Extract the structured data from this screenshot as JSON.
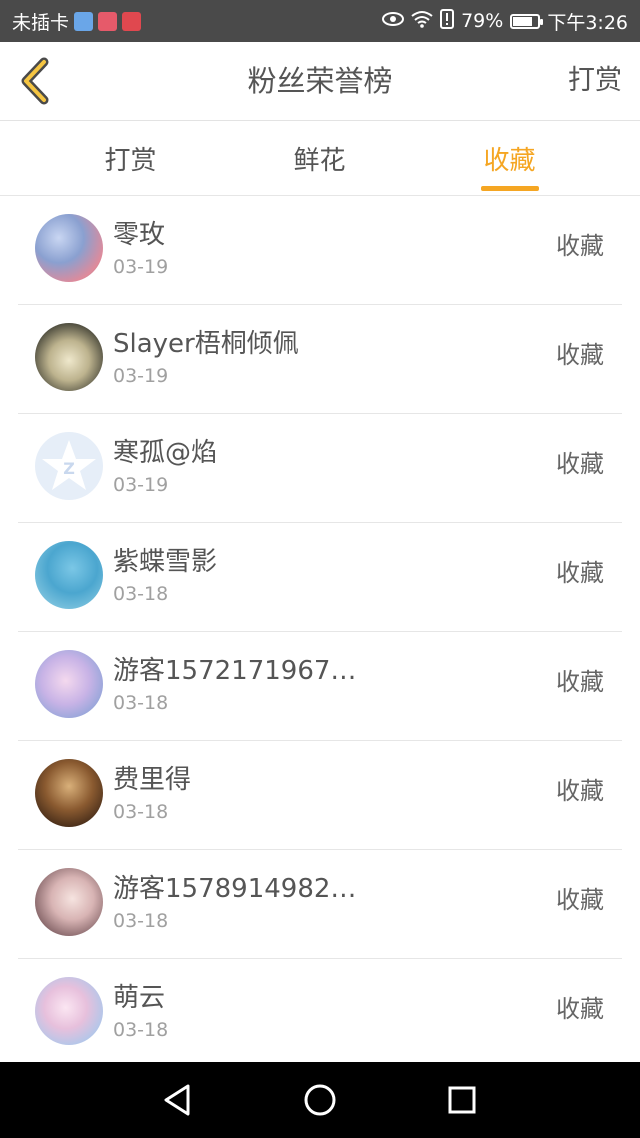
{
  "status_bar": {
    "carrier": "未插卡",
    "battery_percent": "79%",
    "battery_level": 0.79,
    "time": "下午3:26",
    "icons": [
      "eye-icon",
      "wifi-icon",
      "alert-icon",
      "battery-icon"
    ],
    "app_icons": [
      "qq-browser-icon",
      "mall-icon",
      "book-icon"
    ]
  },
  "nav": {
    "title": "粉丝荣誉榜",
    "action": "打赏"
  },
  "tabs": [
    {
      "label": "打赏",
      "active": false
    },
    {
      "label": "鲜花",
      "active": false
    },
    {
      "label": "收藏",
      "active": true
    }
  ],
  "accent_color": "#f5a623",
  "list": [
    {
      "name": "零玫",
      "date": "03-19",
      "action": "收藏"
    },
    {
      "name": "Slayer梧桐倾佩",
      "date": "03-19",
      "action": "收藏"
    },
    {
      "name": "寒孤@焰",
      "date": "03-19",
      "action": "收藏"
    },
    {
      "name": "紫蝶雪影",
      "date": "03-18",
      "action": "收藏"
    },
    {
      "name": "游客1572171967…",
      "date": "03-18",
      "action": "收藏"
    },
    {
      "name": "费里得",
      "date": "03-18",
      "action": "收藏"
    },
    {
      "name": "游客1578914982…",
      "date": "03-18",
      "action": "收藏"
    },
    {
      "name": "萌云",
      "date": "03-18",
      "action": "收藏"
    }
  ]
}
